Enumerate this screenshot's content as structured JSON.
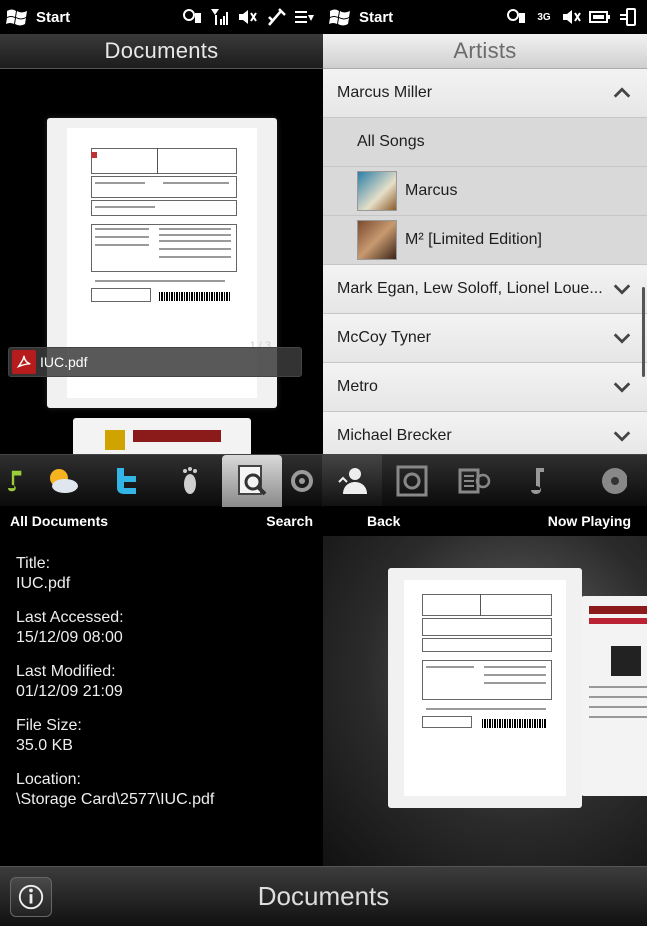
{
  "status": {
    "left": {
      "start_label": "Start"
    },
    "right": {
      "start_label": "Start",
      "network_type": "3G"
    }
  },
  "documents_pane": {
    "title": "Documents",
    "page_indicator": "1 / 3",
    "file_name": "IUC.pdf"
  },
  "artists_pane": {
    "title": "Artists",
    "rows": [
      {
        "label": "Marcus Miller",
        "expanded": true
      },
      {
        "label": "All Songs"
      },
      {
        "label": "Marcus"
      },
      {
        "label": "M² [Limited Edition]"
      },
      {
        "label": "Mark Egan, Lew Soloff, Lionel Loue..."
      },
      {
        "label": "McCoy Tyner"
      },
      {
        "label": "Metro"
      },
      {
        "label": "Michael Brecker"
      }
    ]
  },
  "tabs": [
    {
      "icon": "music-note-green-icon"
    },
    {
      "icon": "weather-icon"
    },
    {
      "icon": "twitter-icon"
    },
    {
      "icon": "footprints-icon"
    },
    {
      "icon": "document-search-icon",
      "active": true
    },
    {
      "icon": "settings-gear-icon"
    },
    {
      "icon": "artist-icon",
      "active": true
    },
    {
      "icon": "album-icon"
    },
    {
      "icon": "video-icon"
    },
    {
      "icon": "music-note-icon"
    },
    {
      "icon": "disc-icon"
    }
  ],
  "softkeys": {
    "left": {
      "left_label": "All Documents",
      "right_label": "Search"
    },
    "right": {
      "left_label": "Back",
      "right_label": "Now Playing"
    }
  },
  "details": {
    "title_label": "Title:",
    "title_value": "IUC.pdf",
    "accessed_label": "Last Accessed:",
    "accessed_value": "15/12/09 08:00",
    "modified_label": "Last Modified:",
    "modified_value": "01/12/09 21:09",
    "size_label": "File Size:",
    "size_value": "35.0 KB",
    "location_label": "Location:",
    "location_value": "\\Storage Card\\2577\\IUC.pdf"
  },
  "bottom_bar": {
    "title": "Documents"
  }
}
